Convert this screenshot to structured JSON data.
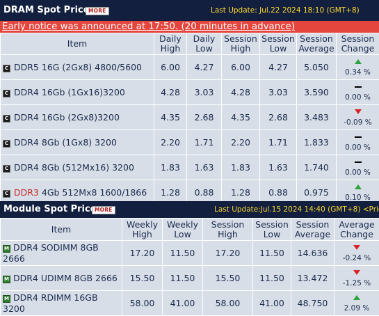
{
  "dram": {
    "title": "DRAM Spot Price",
    "more": "MORE",
    "last_update": "Last Update: Jul.22 2024 18:10 (GMT+8)",
    "notice": "Early notice was announced at 17:50. (20 minutes in advance)",
    "headers": {
      "item": "Item",
      "c1": [
        "Daily",
        "High"
      ],
      "c2": [
        "Daily",
        "Low"
      ],
      "c3": [
        "Session",
        "High"
      ],
      "c4": [
        "Session",
        "Low"
      ],
      "c5": [
        "Session",
        "Average"
      ],
      "c6": [
        "Session",
        "Change"
      ]
    },
    "rows": [
      {
        "name": "DDR5 16G (2Gx8) 4800/5600",
        "prefix": "",
        "v": [
          "6.00",
          "4.27",
          "6.00",
          "4.27",
          "5.050"
        ],
        "trend": "up",
        "change": "0.34 %"
      },
      {
        "name": "DDR4 16Gb (1Gx16)3200",
        "prefix": "",
        "v": [
          "4.28",
          "3.03",
          "4.28",
          "3.03",
          "3.590"
        ],
        "trend": "flat",
        "change": "0.00 %"
      },
      {
        "name": "DDR4 16Gb (2Gx8)3200",
        "prefix": "",
        "v": [
          "4.35",
          "2.68",
          "4.35",
          "2.68",
          "3.483"
        ],
        "trend": "down",
        "change": "-0.09 %"
      },
      {
        "name": "DDR4 8Gb (1Gx8) 3200",
        "prefix": "",
        "v": [
          "2.20",
          "1.71",
          "2.20",
          "1.71",
          "1.833"
        ],
        "trend": "flat",
        "change": "0.00 %"
      },
      {
        "name": "DDR4 8Gb (512Mx16) 3200",
        "prefix": "",
        "v": [
          "1.83",
          "1.63",
          "1.83",
          "1.63",
          "1.740"
        ],
        "trend": "flat",
        "change": "0.00 %"
      },
      {
        "name": " 4Gb 512Mx8 1600/1866",
        "prefix": "DDR3",
        "v": [
          "1.28",
          "0.88",
          "1.28",
          "0.88",
          "0.975"
        ],
        "trend": "up",
        "change": "0.10 %"
      }
    ]
  },
  "module": {
    "title": "Module Spot Price",
    "more": "MORE",
    "last_update": "Last Update:Jul.15 2024 14:40 (GMT+8) <Price",
    "headers": {
      "item": "Item",
      "c1": [
        "Weekly",
        "High"
      ],
      "c2": [
        "Weekly",
        "Low"
      ],
      "c3": [
        "Session",
        "High"
      ],
      "c4": [
        "Session",
        "Low"
      ],
      "c5": [
        "Session",
        "Average"
      ],
      "c6": [
        "Average",
        "Change"
      ]
    },
    "rows": [
      {
        "name": "DDR4 SODIMM 8GB 2666",
        "v": [
          "17.20",
          "11.50",
          "17.20",
          "11.50",
          "14.636"
        ],
        "trend": "down",
        "change": "-0.24 %"
      },
      {
        "name": "DDR4 UDIMM 8GB 2666",
        "v": [
          "15.50",
          "11.50",
          "15.50",
          "11.50",
          "13.472"
        ],
        "trend": "down",
        "change": "-1.25 %"
      },
      {
        "name": "DDR4 RDIMM 16GB 3200",
        "v": [
          "58.00",
          "41.00",
          "58.00",
          "41.00",
          "48.750"
        ],
        "trend": "up",
        "change": "2.09 %"
      }
    ]
  },
  "icons": {
    "chip": "C",
    "module": "M"
  },
  "colors": {
    "header_bg": "#121f3e",
    "update_text": "#ffd92f",
    "notice_bg": "#e4463e",
    "cell_bg": "#d8dee7",
    "up": "#2ea23c",
    "down": "#d8232a",
    "ddr3": "#c62828"
  }
}
